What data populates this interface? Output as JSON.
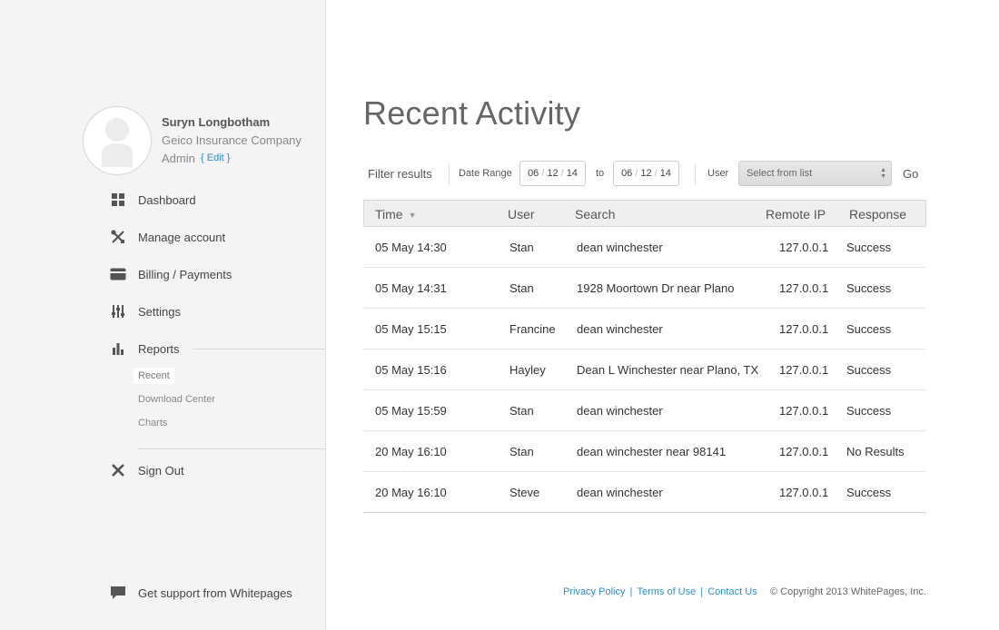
{
  "profile": {
    "name": "Suryn Longbotham",
    "company": "Geico Insurance Company",
    "role": "Admin",
    "edit_label": "{ Edit }"
  },
  "sidebar": {
    "items": [
      {
        "label": "Dashboard",
        "icon": "dashboard-icon"
      },
      {
        "label": "Manage account",
        "icon": "tools-icon"
      },
      {
        "label": "Billing / Payments",
        "icon": "credit-card-icon"
      },
      {
        "label": "Settings",
        "icon": "sliders-icon"
      },
      {
        "label": "Reports",
        "icon": "bar-chart-icon"
      },
      {
        "label": "Sign Out",
        "icon": "close-icon"
      }
    ],
    "report_subitems": [
      {
        "label": "Recent",
        "active": true
      },
      {
        "label": "Download Center",
        "active": false
      },
      {
        "label": "Charts",
        "active": false
      }
    ],
    "support_label": "Get support from Whitepages",
    "support_icon": "chat-bubble-icon"
  },
  "main": {
    "title": "Recent Activity",
    "filter": {
      "filter_label": "Filter results",
      "date_range_label": "Date Range",
      "from": {
        "month": "06",
        "day": "12",
        "year": "14"
      },
      "to_label": "to",
      "to": {
        "month": "06",
        "day": "12",
        "year": "14"
      },
      "user_label": "User",
      "user_select_value": "Select from list",
      "go_label": "Go"
    },
    "table": {
      "columns": [
        "Time",
        "User",
        "Search",
        "Remote IP",
        "Response"
      ],
      "sorted_column": "Time",
      "rows": [
        [
          "05 May 14:30",
          "Stan",
          "dean winchester",
          "127.0.0.1",
          "Success"
        ],
        [
          "05 May 14:31",
          "Stan",
          "1928 Moortown Dr near Plano",
          "127.0.0.1",
          "Success"
        ],
        [
          "05 May 15:15",
          "Francine",
          "dean winchester",
          "127.0.0.1",
          "Success"
        ],
        [
          "05 May 15:16",
          "Hayley",
          "Dean L Winchester near Plano, TX",
          "127.0.0.1",
          "Success"
        ],
        [
          "05 May 15:59",
          "Stan",
          "dean winchester",
          "127.0.0.1",
          "Success"
        ],
        [
          "20 May 16:10",
          "Stan",
          "dean winchester near 98141",
          "127.0.0.1",
          "No Results"
        ],
        [
          "20 May 16:10",
          "Steve",
          "dean winchester",
          "127.0.0.1",
          "Success"
        ]
      ]
    }
  },
  "footer": {
    "links": [
      "Privacy Policy",
      "Terms of Use",
      "Contact Us"
    ],
    "copyright": "© Copyright 2013 WhitePages, Inc."
  },
  "colors": {
    "link": "#2a8fd0",
    "sidebar_bg": "#f4f4f4",
    "header_bg": "#efefef"
  }
}
